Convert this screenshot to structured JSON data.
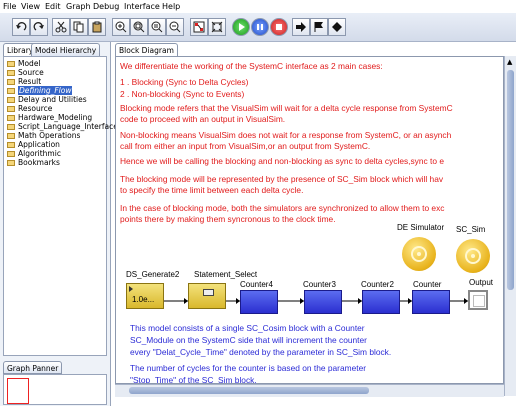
{
  "menu": [
    "File",
    "View",
    "Edit",
    "Graph",
    "Debug",
    "Interface",
    "Help"
  ],
  "toolbar": {
    "icons": [
      "undo-icon",
      "redo-icon",
      "cut-icon",
      "copy-icon",
      "paste-icon",
      "zoom-in-icon",
      "zoom-fit-icon",
      "zoom-reset-icon",
      "zoom-out-icon",
      "layout-icon",
      "fit-icon",
      "run-icon",
      "pause-icon",
      "stop-icon",
      "step-icon",
      "flag-icon",
      "diamond-icon"
    ]
  },
  "left_tabs": {
    "library": "Library",
    "hierarchy": "Model Hierarchy"
  },
  "tree": [
    "Model",
    "Source",
    "Result",
    "Defining_Flow",
    "Delay and Utilities",
    "Resource",
    "Hardware_Modeling",
    "Script_Language_Interface",
    "Math Operations",
    "Application",
    "Algorithmic",
    "Bookmarks"
  ],
  "selected_tree_item": "Defining_Flow",
  "panner_tab": "Graph Panner",
  "diagram_tab": "Block Diagram",
  "canvas_text": {
    "p1": "We differentiate the working of the SystemC interface as 2 main cases:",
    "p2": "1 . Blocking (Sync to Delta Cycles)",
    "p3": "2 . Non-blocking (Sync to Events)",
    "p4a": "Blocking mode refers that the VisualSim will wait for a delta cycle response from SystemC",
    "p4b": "code to proceed with an output in VisualSim.",
    "p5a": "Non-blocking means VisualSim does not wait for a response from SystemC, or an asynch",
    "p5b": "call from either an input from VisualSim,or an output from SystemC.",
    "p6": "Hence we will be calling the blocking and non-blocking as sync to delta cycles,sync to e",
    "p7a": "The blocking mode will be represented by the presence of SC_Sim block which will hav",
    "p7b": "to specify the time limit between each delta cycle.",
    "p8a": "In the case of blocking mode, both the simulators are synchronized to allow them to exc",
    "p8b": "points there by making them syncronous to the clock time.",
    "b1a": "This model consists of a single SC_Cosim block with a Counter",
    "b1b": "SC_Module on the SystemC side that will increment the counter",
    "b1c": "every \"Delat_Cycle_Time\" denoted by the parameter in SC_Sim block.",
    "b2a": "The number of cycles for the counter is based on the parameter",
    "b2b": "\"Stop_Time\" of the SC_Sim block."
  },
  "blocks": {
    "ds_generate": "DS_Generate2",
    "ds_value": "1.0e...",
    "statement_select": "Statement_Select",
    "counter4": "Counter4",
    "counter3": "Counter3",
    "counter2": "Counter2",
    "counter": "Counter",
    "output": "Output",
    "de_simulator": "DE Simulator",
    "sc_sim": "SC_Sim"
  }
}
